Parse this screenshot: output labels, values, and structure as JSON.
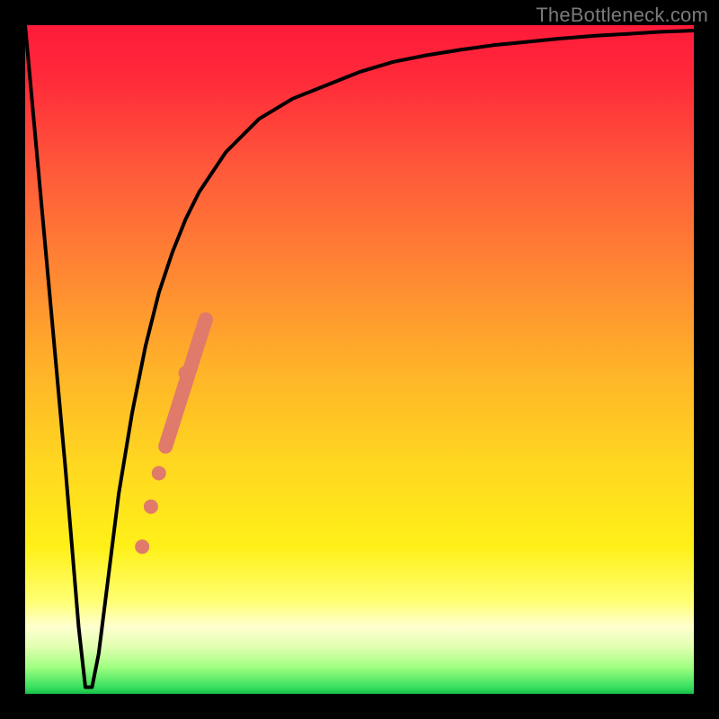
{
  "watermark": "TheBottleneck.com",
  "colors": {
    "frame": "#000000",
    "curve": "#000000",
    "marker": "#e07a6a"
  },
  "chart_data": {
    "type": "line",
    "title": "",
    "xlabel": "",
    "ylabel": "",
    "xlim": [
      0,
      100
    ],
    "ylim": [
      0,
      100
    ],
    "notes": "Y axis inverted visually (0 at top, 100 at bottom). Curve represents bottleneck mismatch; dip to ~0 (optimal) near x≈9.",
    "series": [
      {
        "name": "bottleneck-curve",
        "x": [
          0,
          2,
          4,
          6,
          7,
          8,
          9,
          10,
          11,
          12,
          14,
          16,
          18,
          20,
          22,
          24,
          26,
          30,
          35,
          40,
          45,
          50,
          55,
          60,
          65,
          70,
          75,
          80,
          85,
          90,
          95,
          100
        ],
        "y": [
          100,
          78,
          56,
          34,
          22,
          10,
          1,
          1,
          6,
          14,
          30,
          42,
          52,
          60,
          66,
          71,
          75,
          81,
          86,
          89,
          91,
          93,
          94.5,
          95.5,
          96.3,
          97,
          97.5,
          98,
          98.4,
          98.7,
          99,
          99.2
        ]
      }
    ],
    "markers": {
      "name": "highlight-segment",
      "points": [
        {
          "x": 17.5,
          "y": 22
        },
        {
          "x": 18.8,
          "y": 28
        },
        {
          "x": 20.0,
          "y": 33
        },
        {
          "x": 24.0,
          "y": 48
        }
      ],
      "thick_segment": {
        "x_start": 21.0,
        "x_end": 27.0,
        "y_start": 37,
        "y_end": 56
      }
    }
  }
}
